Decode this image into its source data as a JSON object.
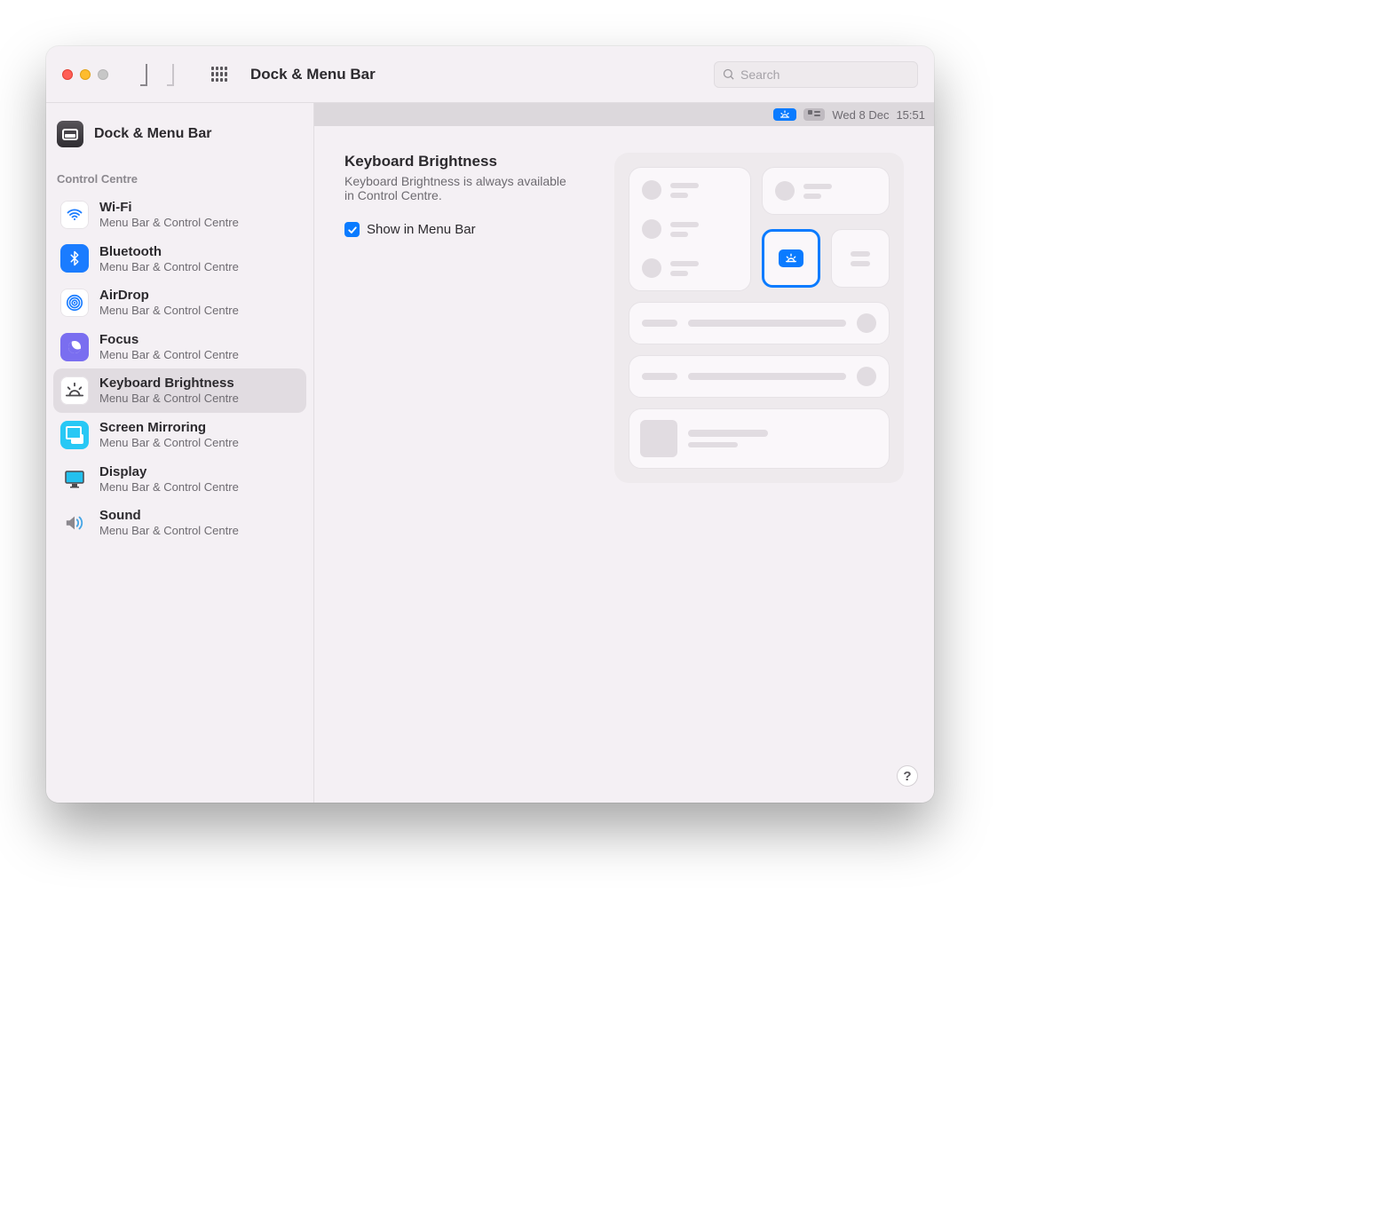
{
  "window": {
    "title": "Dock & Menu Bar",
    "search_placeholder": "Search"
  },
  "preview_menubar": {
    "date": "Wed 8 Dec",
    "time": "15:51"
  },
  "sidebar": {
    "top_label": "Dock & Menu Bar",
    "section_label": "Control Centre",
    "subtitle": "Menu Bar & Control Centre",
    "items": {
      "wifi": {
        "title": "Wi-Fi"
      },
      "bluetooth": {
        "title": "Bluetooth"
      },
      "airdrop": {
        "title": "AirDrop"
      },
      "focus": {
        "title": "Focus"
      },
      "keyboard": {
        "title": "Keyboard Brightness"
      },
      "mirror": {
        "title": "Screen Mirroring"
      },
      "display": {
        "title": "Display"
      },
      "sound": {
        "title": "Sound"
      }
    }
  },
  "pane": {
    "title": "Keyboard Brightness",
    "description": "Keyboard Brightness is always available in Control Centre.",
    "checkbox_label": "Show in Menu Bar",
    "checkbox_checked": true
  },
  "help_glyph": "?"
}
